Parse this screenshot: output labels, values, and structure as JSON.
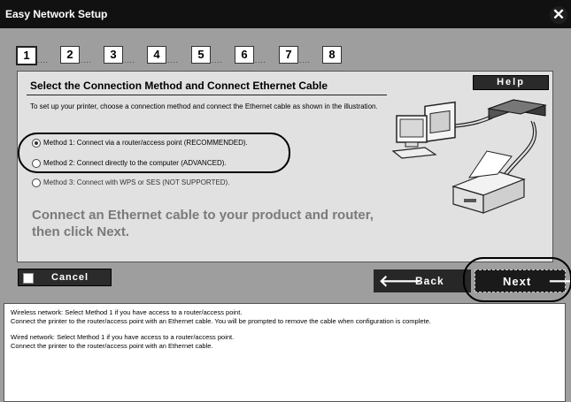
{
  "window": {
    "title": "Easy Network Setup",
    "close_glyph": "✕"
  },
  "steps": [
    {
      "label": "1",
      "active": true
    },
    {
      "label": "2"
    },
    {
      "label": "3"
    },
    {
      "label": "4"
    },
    {
      "label": "5"
    },
    {
      "label": "6"
    },
    {
      "label": "7"
    },
    {
      "label": "8"
    }
  ],
  "step_dots": "....",
  "panel": {
    "title": "Select the Connection Method and Connect Ethernet Cable",
    "help_label": "Help",
    "instructions": "To set up your printer, choose a connection method and connect the Ethernet cable as shown in the illustration.",
    "options": [
      {
        "label": "Method 1: Connect via a router/access point (RECOMMENDED).",
        "selected": true
      },
      {
        "label": "Method 2: Connect directly to the computer (ADVANCED).",
        "selected": false
      },
      {
        "label": "Method 3: Connect with WPS or SES (NOT SUPPORTED).",
        "selected": false
      }
    ],
    "message": "Connect an Ethernet cable to your product and router, then click Next."
  },
  "buttons": {
    "cancel": "Cancel",
    "back": "Back",
    "next": "Next",
    "back_arrow": "🡐",
    "next_arrow": "🡒"
  },
  "description": {
    "line1": "Wireless network: Select Method 1 if you have access to a router/access point.",
    "line2": "Connect the printer to the router/access point with an Ethernet cable. You will be prompted to remove the cable when configuration is complete.",
    "line3": "Wired network: Select Method 1 if you have access to a router/access point.",
    "line4": "Connect the printer to the router/access point with an Ethernet cable."
  },
  "icons": [
    "close-icon",
    "computer-icon",
    "router-icon",
    "printer-icon",
    "arrow-left-icon",
    "arrow-right-icon"
  ]
}
